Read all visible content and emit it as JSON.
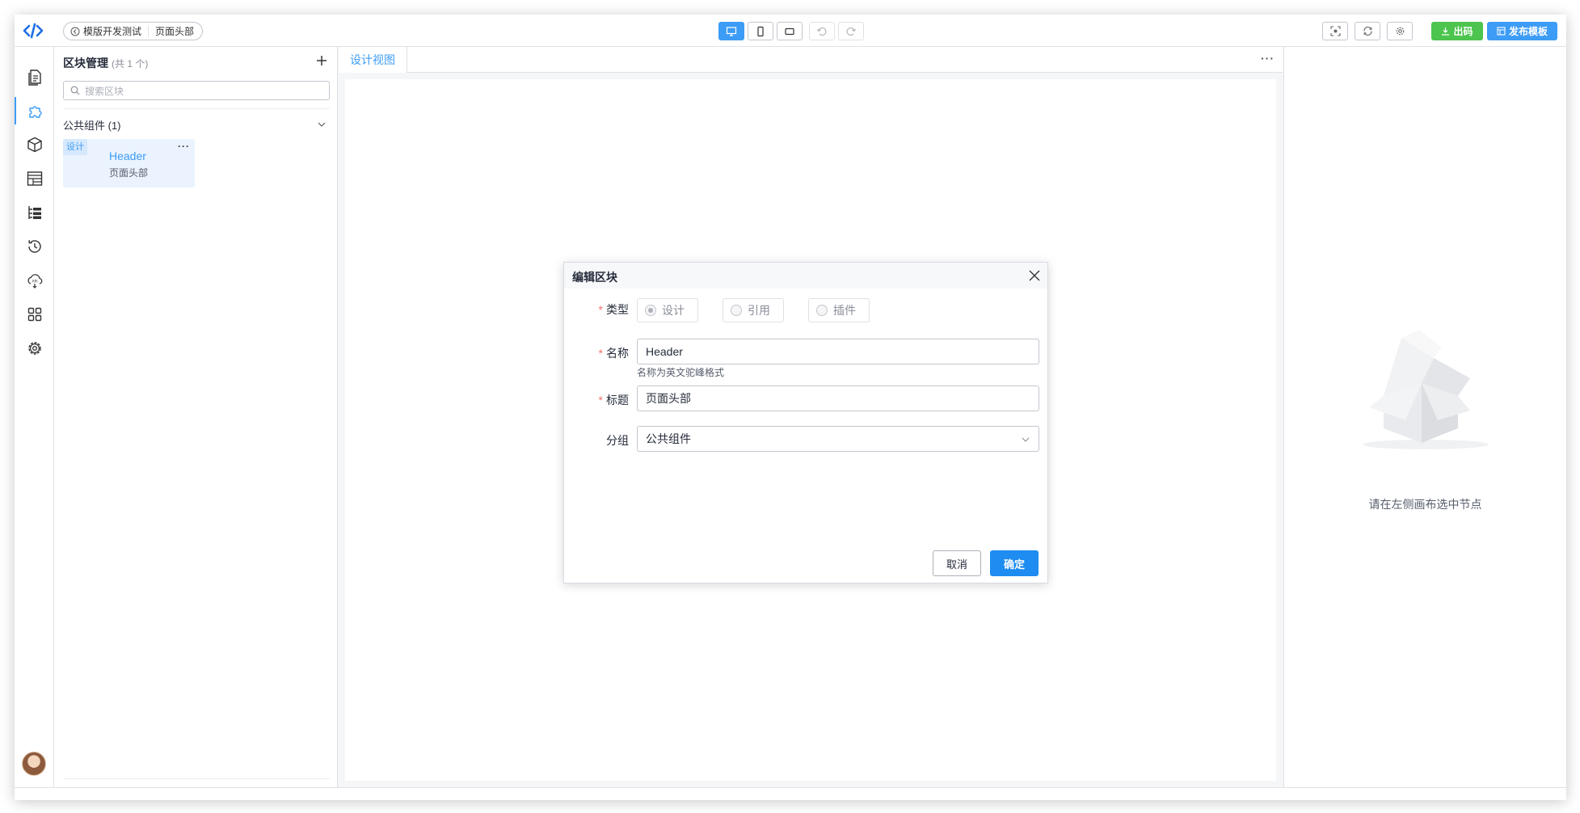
{
  "topbar": {
    "breadcrumb": {
      "app": "模版开发测试",
      "page": "页面头部"
    },
    "devices": [
      "desktop",
      "tablet",
      "mobile"
    ],
    "export_label": "出码",
    "publish_label": "发布模板",
    "colors": {
      "accent": "#3d9cf5",
      "export_bg": "#4cc44e",
      "publish_bg": "#3d9cf5"
    }
  },
  "rail": {
    "icons": [
      "page-icon",
      "puzzle-icon",
      "cube-icon",
      "layout-icon",
      "outline-icon",
      "history-icon",
      "api-cloud-icon",
      "apps-icon",
      "settings-icon"
    ],
    "active": "puzzle-icon"
  },
  "block_panel": {
    "title": "区块管理",
    "count": "(共 1 个)",
    "search_placeholder": "搜索区块",
    "group_title": "公共组件 (1)",
    "blocks": [
      {
        "tag": "设计",
        "name": "Header",
        "title": "页面头部"
      }
    ]
  },
  "canvas": {
    "tab_label": "设计视图"
  },
  "right_panel": {
    "empty_text": "请在左侧画布选中节点"
  },
  "modal": {
    "title": "编辑区块",
    "type_label": "类型",
    "type_options": [
      "设计",
      "引用",
      "插件"
    ],
    "type_selected": "设计",
    "name_label": "名称",
    "name_value": "Header",
    "name_hint": "名称为英文驼峰格式",
    "title_label": "标题",
    "title_value": "页面头部",
    "group_label": "分组",
    "group_value": "公共组件",
    "cancel_label": "取消",
    "confirm_label": "确定"
  }
}
